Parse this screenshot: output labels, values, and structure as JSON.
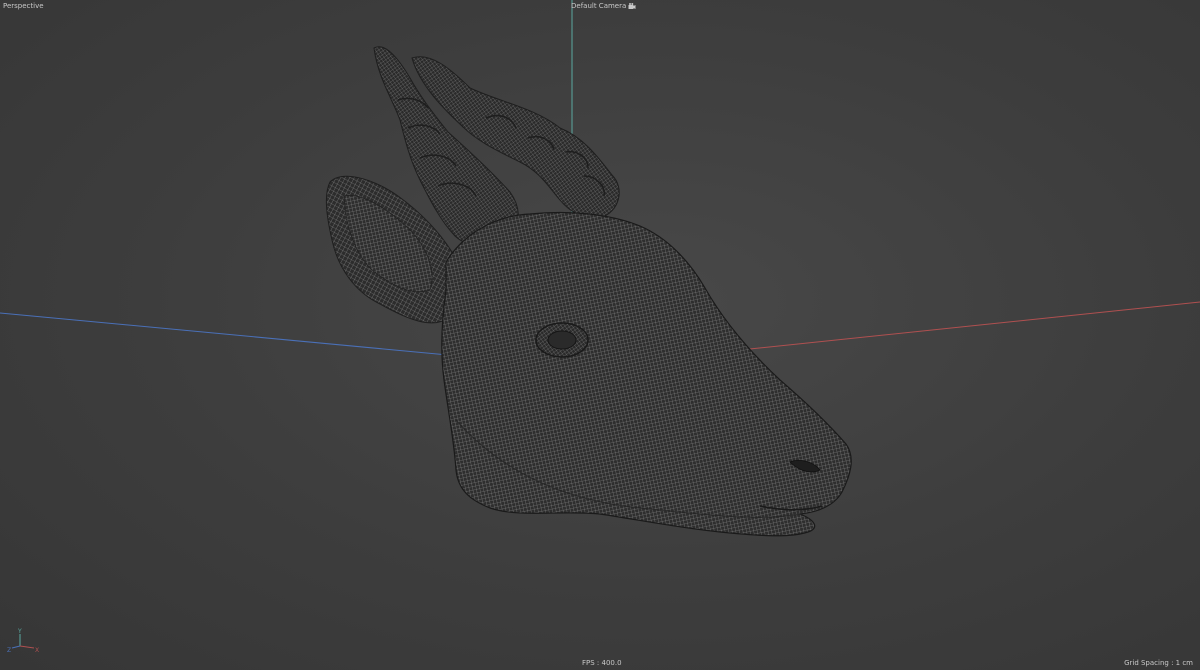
{
  "viewport": {
    "view_name": "Perspective",
    "camera_name": "Default Camera",
    "camera_icon": "camera-icon",
    "fps": "FPS : 400.0",
    "grid_spacing": "Grid Spacing : 1 cm"
  },
  "gizmo": {
    "axes": [
      "Y",
      "Z",
      "X"
    ]
  },
  "scene": {
    "object": "antelope head wireframe mesh",
    "colors": {
      "background": "#3c3c3c",
      "mesh_fill": "#2d2d2d",
      "mesh_wire": "#8a8a8a",
      "x_axis": "#b05050",
      "y_axis": "#5aa8a0",
      "z_axis": "#4a70b8"
    }
  }
}
